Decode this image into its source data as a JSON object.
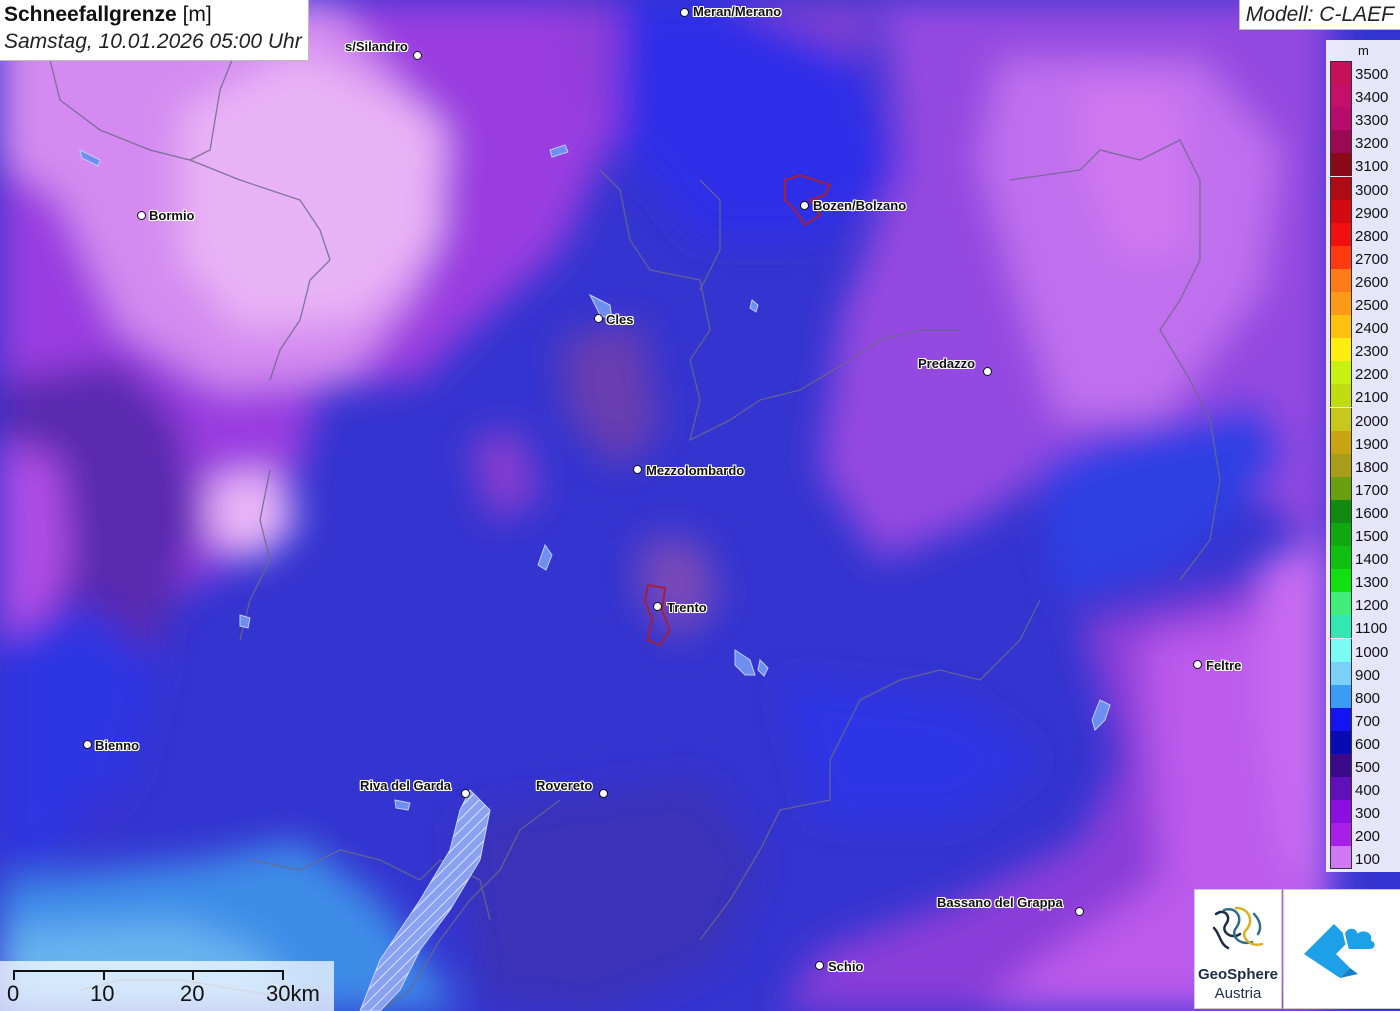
{
  "header": {
    "title": "Schneefallgrenze",
    "unit": "[m]",
    "datetime": "Samstag, 10.01.2026 05:00 Uhr",
    "model": "Modell: C-LAEF"
  },
  "legend": {
    "unit": "m",
    "items": [
      {
        "value": "3500",
        "color": "#c8105a"
      },
      {
        "value": "3400",
        "color": "#c4106a"
      },
      {
        "value": "3300",
        "color": "#b80c6c"
      },
      {
        "value": "3200",
        "color": "#9a0a52"
      },
      {
        "value": "3100",
        "color": "#8a0a18"
      },
      {
        "value": "3000",
        "color": "#b00a14"
      },
      {
        "value": "2900",
        "color": "#d40a10"
      },
      {
        "value": "2800",
        "color": "#f01010"
      },
      {
        "value": "2700",
        "color": "#ff3a10"
      },
      {
        "value": "2600",
        "color": "#ff7a18"
      },
      {
        "value": "2500",
        "color": "#ff9a18"
      },
      {
        "value": "2400",
        "color": "#ffc010"
      },
      {
        "value": "2300",
        "color": "#ffee10"
      },
      {
        "value": "2200",
        "color": "#c8f010"
      },
      {
        "value": "2100",
        "color": "#c0dc10"
      },
      {
        "value": "2000",
        "color": "#c8c81c"
      },
      {
        "value": "1900",
        "color": "#c8a410"
      },
      {
        "value": "1800",
        "color": "#a89c18"
      },
      {
        "value": "1700",
        "color": "#6aa010"
      },
      {
        "value": "1600",
        "color": "#108a10"
      },
      {
        "value": "1500",
        "color": "#10a810"
      },
      {
        "value": "1400",
        "color": "#10c010"
      },
      {
        "value": "1300",
        "color": "#10e010"
      },
      {
        "value": "1200",
        "color": "#40ec7a"
      },
      {
        "value": "1100",
        "color": "#30e8b0"
      },
      {
        "value": "1000",
        "color": "#7afcf4"
      },
      {
        "value": "900",
        "color": "#7ad0f8"
      },
      {
        "value": "800",
        "color": "#3a9cf4"
      },
      {
        "value": "700",
        "color": "#1414f0"
      },
      {
        "value": "600",
        "color": "#0a0ab4"
      },
      {
        "value": "500",
        "color": "#3a0a8a"
      },
      {
        "value": "400",
        "color": "#6010b8"
      },
      {
        "value": "300",
        "color": "#8a10e0"
      },
      {
        "value": "200",
        "color": "#a820e8"
      },
      {
        "value": "100",
        "color": "#d078f4"
      }
    ]
  },
  "cities": [
    {
      "name": "Meran/Merano"
    },
    {
      "name": "s/Silandro"
    },
    {
      "name": "Bormio"
    },
    {
      "name": "Bozen/Bolzano"
    },
    {
      "name": "Cles"
    },
    {
      "name": "Predazzo"
    },
    {
      "name": "Mezzolombardo"
    },
    {
      "name": "Trento"
    },
    {
      "name": "Feltre"
    },
    {
      "name": "Bienno"
    },
    {
      "name": "Riva del Garda"
    },
    {
      "name": "Rovereto"
    },
    {
      "name": "Bassano del Grappa"
    },
    {
      "name": "Schio"
    }
  ],
  "scalebar": {
    "labels": [
      "0",
      "10",
      "20",
      "30km"
    ]
  },
  "logos": {
    "geosphere_line1": "GeoSphere",
    "geosphere_line2": "Austria"
  }
}
